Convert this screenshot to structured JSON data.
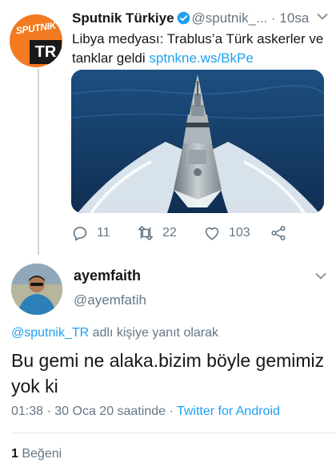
{
  "parent_tweet": {
    "display_name": "Sputnik Türkiye",
    "handle": "@sputnik_...",
    "separator": "·",
    "time": "10sa",
    "text": "Libya medyası: Trablus’a Türk askerler ve tanklar geldi",
    "link": "sptnkne.ws/BkPe",
    "avatar_logo_word": "SPUTNIK",
    "avatar_logo_code": "TR",
    "actions": {
      "replies": "11",
      "retweets": "22",
      "likes": "103"
    }
  },
  "reply_tweet": {
    "display_name": "ayemfaith",
    "handle": "@ayemfatih",
    "replying_to_mention": "@sputnik_TR",
    "replying_to_suffix": " adlı kişiye yanıt olarak",
    "text": "Bu gemi ne alaka.bizim böyle gemimiz yok ki",
    "timestamp": "01:38 · 30 Oca 20 saatinde · ",
    "client": "Twitter for Android"
  },
  "likes_summary": {
    "count": "1",
    "label": " Beğeni"
  },
  "colors": {
    "accent": "#1da1f2",
    "secondary_text": "#657786",
    "brand_orange": "#f27a21"
  }
}
